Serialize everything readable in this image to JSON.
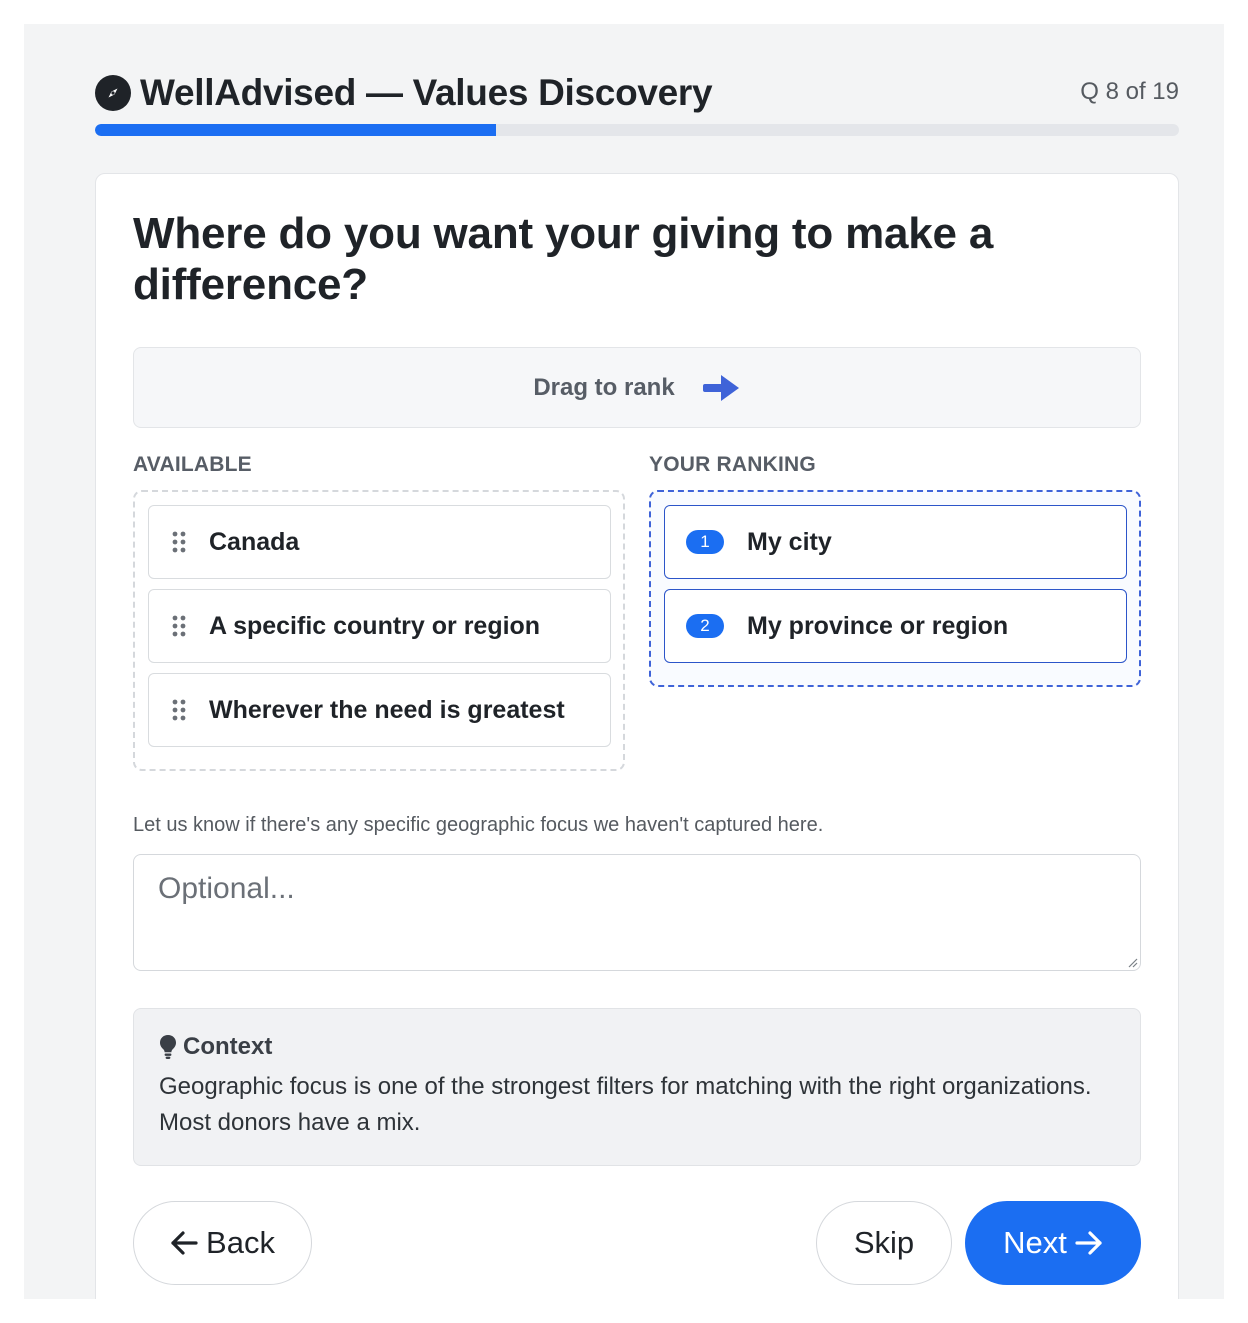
{
  "app": {
    "title": "WellAdvised — Values Discovery",
    "question_counter": "Q 8 of 19",
    "progress_fraction": 0.37
  },
  "question": {
    "text": "Where do you want your giving to make a difference?",
    "hint": "Drag to rank"
  },
  "available": {
    "label": "AVAILABLE",
    "items": [
      "Canada",
      "A specific country or region",
      "Wherever the need is greatest"
    ]
  },
  "ranking": {
    "label": "YOUR RANKING",
    "items": [
      {
        "rank": "1",
        "label": "My city"
      },
      {
        "rank": "2",
        "label": "My province or region"
      }
    ]
  },
  "note": {
    "text": "Let us know if there's any specific geographic focus we haven't captured here.",
    "placeholder": "Optional...",
    "value": ""
  },
  "context": {
    "title": "Context",
    "body": "Geographic focus is one of the strongest filters for matching with the right organizations. Most donors have a mix."
  },
  "buttons": {
    "back": "Back",
    "skip": "Skip",
    "next": "Next"
  },
  "colors": {
    "accent": "#1b6ef2",
    "ranking_border": "#3f63d8",
    "text": "#1f2328"
  },
  "icons": {
    "brand": "compass-icon",
    "hint": "arrow-right-icon",
    "drag": "drag-handle-icon",
    "context": "lightbulb-icon",
    "back": "arrow-left-icon",
    "next": "arrow-right-icon"
  }
}
